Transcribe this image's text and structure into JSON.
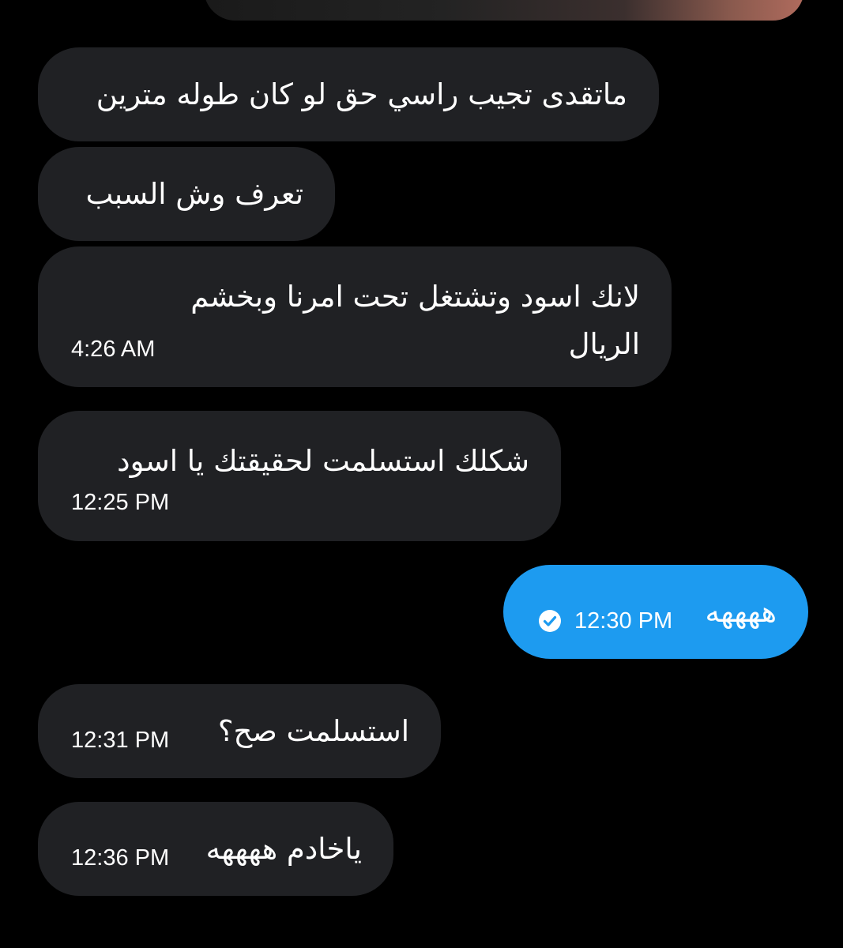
{
  "conversation": {
    "messages": [
      {
        "text": "ماتقدى تجيب راسي حق لو كان طوله مترين",
        "time": "",
        "direction": "incoming"
      },
      {
        "text": "تعرف وش السبب",
        "time": "",
        "direction": "incoming"
      },
      {
        "text": "لانك اسود وتشتغل تحت امرنا وبخشم الريال",
        "time": "4:26 AM",
        "direction": "incoming"
      },
      {
        "text": "شكلك استسلمت لحقيقتك يا اسود",
        "time": "12:25 PM",
        "direction": "incoming"
      },
      {
        "text": "ههههه",
        "time": "12:30 PM",
        "direction": "outgoing",
        "status": "sent-check-icon"
      },
      {
        "text": "استسلمت صح؟",
        "time": "12:31 PM",
        "direction": "incoming"
      },
      {
        "text": "ياخادم ههههه",
        "time": "12:36 PM",
        "direction": "incoming"
      }
    ]
  },
  "colors": {
    "background": "#000000",
    "incoming_bubble": "#202124",
    "outgoing_bubble": "#1d9bf0",
    "text": "#ffffff"
  }
}
